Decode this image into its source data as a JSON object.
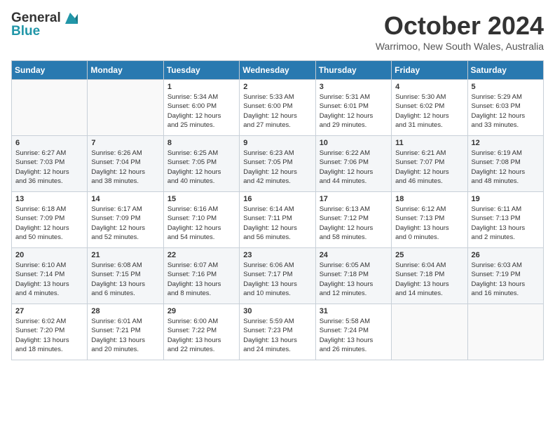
{
  "logo": {
    "general": "General",
    "blue": "Blue"
  },
  "title": "October 2024",
  "location": "Warrimoo, New South Wales, Australia",
  "days_header": [
    "Sunday",
    "Monday",
    "Tuesday",
    "Wednesday",
    "Thursday",
    "Friday",
    "Saturday"
  ],
  "weeks": [
    [
      {
        "day": "",
        "detail": ""
      },
      {
        "day": "",
        "detail": ""
      },
      {
        "day": "1",
        "detail": "Sunrise: 5:34 AM\nSunset: 6:00 PM\nDaylight: 12 hours\nand 25 minutes."
      },
      {
        "day": "2",
        "detail": "Sunrise: 5:33 AM\nSunset: 6:00 PM\nDaylight: 12 hours\nand 27 minutes."
      },
      {
        "day": "3",
        "detail": "Sunrise: 5:31 AM\nSunset: 6:01 PM\nDaylight: 12 hours\nand 29 minutes."
      },
      {
        "day": "4",
        "detail": "Sunrise: 5:30 AM\nSunset: 6:02 PM\nDaylight: 12 hours\nand 31 minutes."
      },
      {
        "day": "5",
        "detail": "Sunrise: 5:29 AM\nSunset: 6:03 PM\nDaylight: 12 hours\nand 33 minutes."
      }
    ],
    [
      {
        "day": "6",
        "detail": "Sunrise: 6:27 AM\nSunset: 7:03 PM\nDaylight: 12 hours\nand 36 minutes."
      },
      {
        "day": "7",
        "detail": "Sunrise: 6:26 AM\nSunset: 7:04 PM\nDaylight: 12 hours\nand 38 minutes."
      },
      {
        "day": "8",
        "detail": "Sunrise: 6:25 AM\nSunset: 7:05 PM\nDaylight: 12 hours\nand 40 minutes."
      },
      {
        "day": "9",
        "detail": "Sunrise: 6:23 AM\nSunset: 7:05 PM\nDaylight: 12 hours\nand 42 minutes."
      },
      {
        "day": "10",
        "detail": "Sunrise: 6:22 AM\nSunset: 7:06 PM\nDaylight: 12 hours\nand 44 minutes."
      },
      {
        "day": "11",
        "detail": "Sunrise: 6:21 AM\nSunset: 7:07 PM\nDaylight: 12 hours\nand 46 minutes."
      },
      {
        "day": "12",
        "detail": "Sunrise: 6:19 AM\nSunset: 7:08 PM\nDaylight: 12 hours\nand 48 minutes."
      }
    ],
    [
      {
        "day": "13",
        "detail": "Sunrise: 6:18 AM\nSunset: 7:09 PM\nDaylight: 12 hours\nand 50 minutes."
      },
      {
        "day": "14",
        "detail": "Sunrise: 6:17 AM\nSunset: 7:09 PM\nDaylight: 12 hours\nand 52 minutes."
      },
      {
        "day": "15",
        "detail": "Sunrise: 6:16 AM\nSunset: 7:10 PM\nDaylight: 12 hours\nand 54 minutes."
      },
      {
        "day": "16",
        "detail": "Sunrise: 6:14 AM\nSunset: 7:11 PM\nDaylight: 12 hours\nand 56 minutes."
      },
      {
        "day": "17",
        "detail": "Sunrise: 6:13 AM\nSunset: 7:12 PM\nDaylight: 12 hours\nand 58 minutes."
      },
      {
        "day": "18",
        "detail": "Sunrise: 6:12 AM\nSunset: 7:13 PM\nDaylight: 13 hours\nand 0 minutes."
      },
      {
        "day": "19",
        "detail": "Sunrise: 6:11 AM\nSunset: 7:13 PM\nDaylight: 13 hours\nand 2 minutes."
      }
    ],
    [
      {
        "day": "20",
        "detail": "Sunrise: 6:10 AM\nSunset: 7:14 PM\nDaylight: 13 hours\nand 4 minutes."
      },
      {
        "day": "21",
        "detail": "Sunrise: 6:08 AM\nSunset: 7:15 PM\nDaylight: 13 hours\nand 6 minutes."
      },
      {
        "day": "22",
        "detail": "Sunrise: 6:07 AM\nSunset: 7:16 PM\nDaylight: 13 hours\nand 8 minutes."
      },
      {
        "day": "23",
        "detail": "Sunrise: 6:06 AM\nSunset: 7:17 PM\nDaylight: 13 hours\nand 10 minutes."
      },
      {
        "day": "24",
        "detail": "Sunrise: 6:05 AM\nSunset: 7:18 PM\nDaylight: 13 hours\nand 12 minutes."
      },
      {
        "day": "25",
        "detail": "Sunrise: 6:04 AM\nSunset: 7:18 PM\nDaylight: 13 hours\nand 14 minutes."
      },
      {
        "day": "26",
        "detail": "Sunrise: 6:03 AM\nSunset: 7:19 PM\nDaylight: 13 hours\nand 16 minutes."
      }
    ],
    [
      {
        "day": "27",
        "detail": "Sunrise: 6:02 AM\nSunset: 7:20 PM\nDaylight: 13 hours\nand 18 minutes."
      },
      {
        "day": "28",
        "detail": "Sunrise: 6:01 AM\nSunset: 7:21 PM\nDaylight: 13 hours\nand 20 minutes."
      },
      {
        "day": "29",
        "detail": "Sunrise: 6:00 AM\nSunset: 7:22 PM\nDaylight: 13 hours\nand 22 minutes."
      },
      {
        "day": "30",
        "detail": "Sunrise: 5:59 AM\nSunset: 7:23 PM\nDaylight: 13 hours\nand 24 minutes."
      },
      {
        "day": "31",
        "detail": "Sunrise: 5:58 AM\nSunset: 7:24 PM\nDaylight: 13 hours\nand 26 minutes."
      },
      {
        "day": "",
        "detail": ""
      },
      {
        "day": "",
        "detail": ""
      }
    ]
  ]
}
